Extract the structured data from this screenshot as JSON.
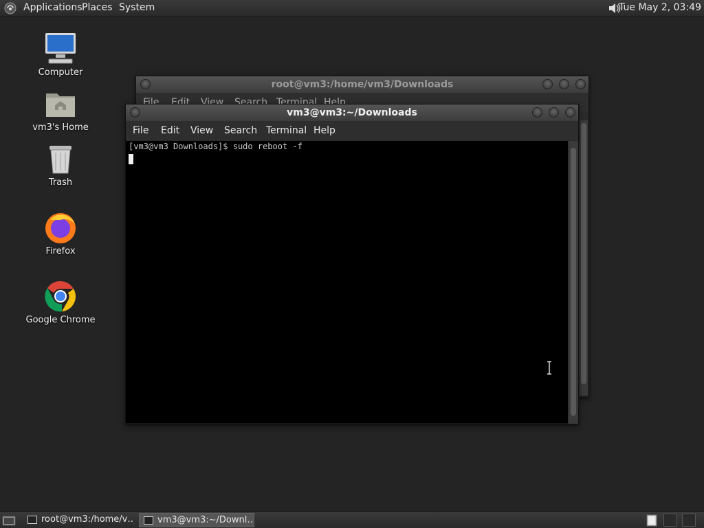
{
  "top_panel": {
    "menus": [
      "Applications",
      "Places",
      "System"
    ],
    "clock": "Tue May  2, 03:49"
  },
  "desktop_icons": [
    {
      "label": "Computer",
      "icon": "computer-icon"
    },
    {
      "label": "vm3's Home",
      "icon": "home-folder-icon"
    },
    {
      "label": "Trash",
      "icon": "trash-icon"
    },
    {
      "label": "Firefox",
      "icon": "firefox-icon"
    },
    {
      "label": "Google Chrome",
      "icon": "chrome-icon"
    }
  ],
  "back_window": {
    "title": "root@vm3:/home/vm3/Downloads",
    "menu": [
      "File",
      "Edit",
      "View",
      "Search",
      "Terminal",
      "Help"
    ]
  },
  "front_window": {
    "title": "vm3@vm3:~/Downloads",
    "menu": [
      "File",
      "Edit",
      "View",
      "Search",
      "Terminal",
      "Help"
    ],
    "terminal_line": "[vm3@vm3 Downloads]$ sudo reboot -f"
  },
  "taskbar": {
    "items": [
      "root@vm3:/home/v…",
      "vm3@vm3:~/Downl…"
    ]
  },
  "colors": {
    "desktop": "#242424",
    "terminal_bg": "#000000",
    "panel": "#333333"
  }
}
